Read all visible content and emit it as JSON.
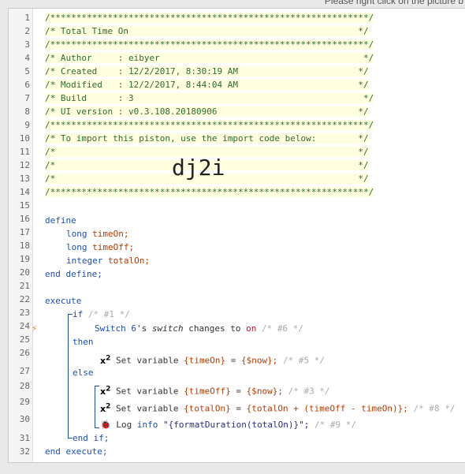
{
  "hint": "Please right click on the picture b",
  "line_numbers": [
    "1",
    "2",
    "3",
    "4",
    "5",
    "6",
    "7",
    "8",
    "9",
    "10",
    "11",
    "12",
    "13",
    "14",
    "15",
    "16",
    "17",
    "18",
    "19",
    "20",
    "21",
    "22",
    "23",
    "24",
    "25",
    "26",
    "27",
    "28",
    "29",
    "30",
    "31",
    "32"
  ],
  "header": {
    "stars": "/*************************************************************/",
    "title": "/* Total Time On                                            */",
    "author": "/* Author     : eibyer                                       */",
    "created": "/* Created    : 12/2/2017, 8:30:19 AM                       */",
    "modified": "/* Modified   : 12/2/2017, 8:44:04 AM                       */",
    "build": "/* Build      : 3                                            */",
    "ui_version": "/* UI version : v0.3.108.20180906                           */",
    "import_note": "/* To import this piston, use the import code below:        */",
    "blank": "/*                                                          */",
    "import_code": "dj2i"
  },
  "code": {
    "define": "define",
    "long1": "long",
    "timeOn_decl": "timeOn;",
    "long2": "long",
    "timeOff_decl": "timeOff;",
    "integer": "integer",
    "totalOn_decl": "totalOn;",
    "end_define": "end define;",
    "execute": "execute",
    "if": "if",
    "if_cmt": "/* #1 */",
    "switch_dev": "Switch 6",
    "switch_s": "'s",
    "switch_attr": "switch",
    "changes_to": "changes to",
    "on_value": "on",
    "switch_cmt": "/* #6 */",
    "then": "then",
    "set1_label": "Set variable",
    "set1_var": "{timeOn}",
    "set1_eq": "=",
    "set1_val": "{$now};",
    "set1_cmt": "/* #5 */",
    "else": "else",
    "set2_label": "Set variable",
    "set2_var": "{timeOff}",
    "set2_eq": "=",
    "set2_val": "{$now};",
    "set2_cmt": "/* #3 */",
    "set3_label": "Set variable",
    "set3_var": "{totalOn}",
    "set3_eq": "=",
    "set3_val": "{totalOn + (timeOff - timeOn)};",
    "set3_cmt": "/* #8 */",
    "log_label": "Log",
    "log_level": "info",
    "log_msg": "\"{formatDuration(totalOn)}\";",
    "log_cmt": "/* #9 */",
    "end_if": "end if;",
    "end_execute": "end execute;"
  },
  "icons": {
    "x2_icon_1": "x",
    "x2_icon_2": "x",
    "x2_icon_3": "x",
    "x2_sup": "2",
    "bug_icon": "🐞",
    "flash_icon": "⚡"
  },
  "colors": {
    "keyword": "#1a4fb2",
    "variable": "#b33a00",
    "comment_bg": "#ffffe0",
    "comment_text": "#2e6b2e"
  }
}
